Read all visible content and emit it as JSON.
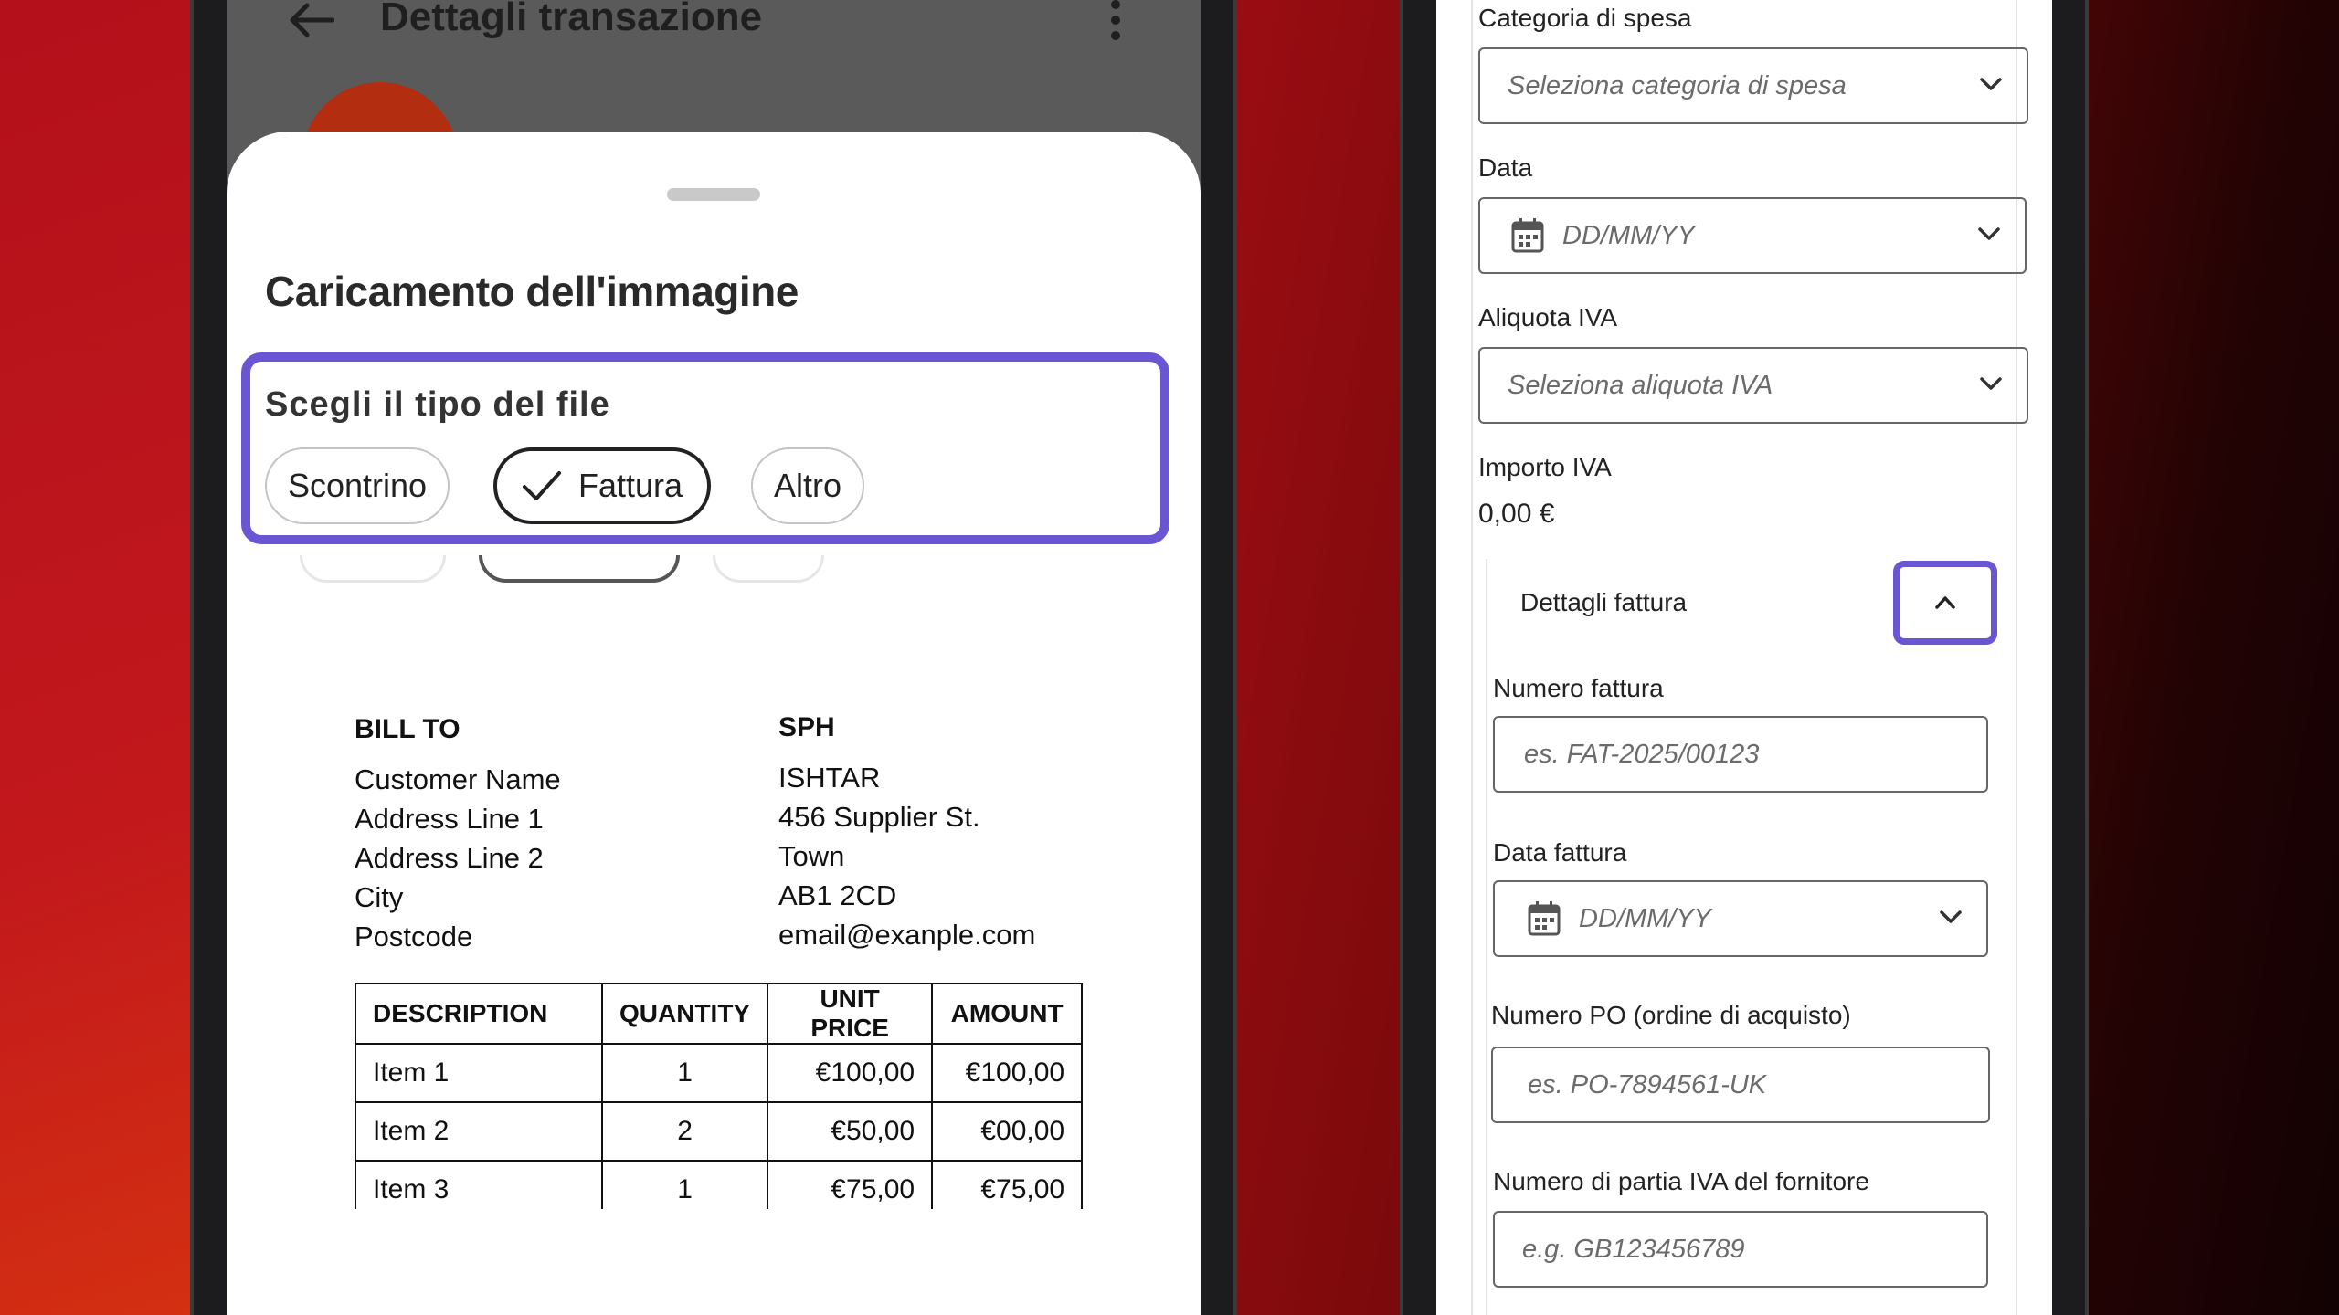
{
  "left": {
    "appbar": {
      "title": "Dettagli transazione",
      "back_icon": "arrow-left-icon",
      "menu_icon": "more-vert-icon"
    },
    "sheet": {
      "title": "Caricamento dell'immagine",
      "filetype_label": "Scegli il tipo del file",
      "chips": [
        {
          "label": "Scontrino",
          "selected": false
        },
        {
          "label": "Fattura",
          "selected": true
        },
        {
          "label": "Altro",
          "selected": false
        }
      ]
    },
    "invoice": {
      "bill_to": {
        "heading": "BILL TO",
        "lines": [
          "Customer Name",
          "Address Line 1",
          "Address Line 2",
          "City",
          "Postcode"
        ]
      },
      "supplier": {
        "heading": "SPH",
        "lines": [
          "ISHTAR",
          "456 Supplier St.",
          "Town",
          "AB1 2CD",
          "email@exanple.com"
        ]
      },
      "table": {
        "headers": [
          "DESCRIPTION",
          "QUANTITY",
          "UNIT PRICE",
          "AMOUNT"
        ],
        "rows": [
          [
            "Item 1",
            "1",
            "€100,00",
            "€100,00"
          ],
          [
            "Item 2",
            "2",
            "€50,00",
            "€00,00"
          ],
          [
            "Item 3",
            "1",
            "€75,00",
            "€75,00"
          ]
        ]
      }
    }
  },
  "right": {
    "categoria": {
      "label": "Categoria di spesa",
      "placeholder": "Seleziona categoria di spesa"
    },
    "data": {
      "label": "Data",
      "placeholder": "DD/MM/YY"
    },
    "aliquota": {
      "label": "Aliquota IVA",
      "placeholder": "Seleziona aliquota IVA"
    },
    "importo": {
      "label": "Importo IVA",
      "value": "0,00 €"
    },
    "dettagli": {
      "title": "Dettagli fattura",
      "numero_fattura": {
        "label": "Numero fattura",
        "placeholder": "es. FAT-2025/00123"
      },
      "data_fattura": {
        "label": "Data fattura",
        "placeholder": "DD/MM/YY"
      },
      "numero_po": {
        "label": "Numero PO (ordine di acquisto)",
        "placeholder": "es. PO-7894561-UK"
      },
      "partita_iva": {
        "label": "Numero di partia IVA del fornitore",
        "placeholder": "e.g. GB123456789"
      }
    }
  },
  "colors": {
    "highlight": "#6a56d2",
    "avatar": "#b32d10",
    "appbar_bg": "#5a5a5a"
  }
}
